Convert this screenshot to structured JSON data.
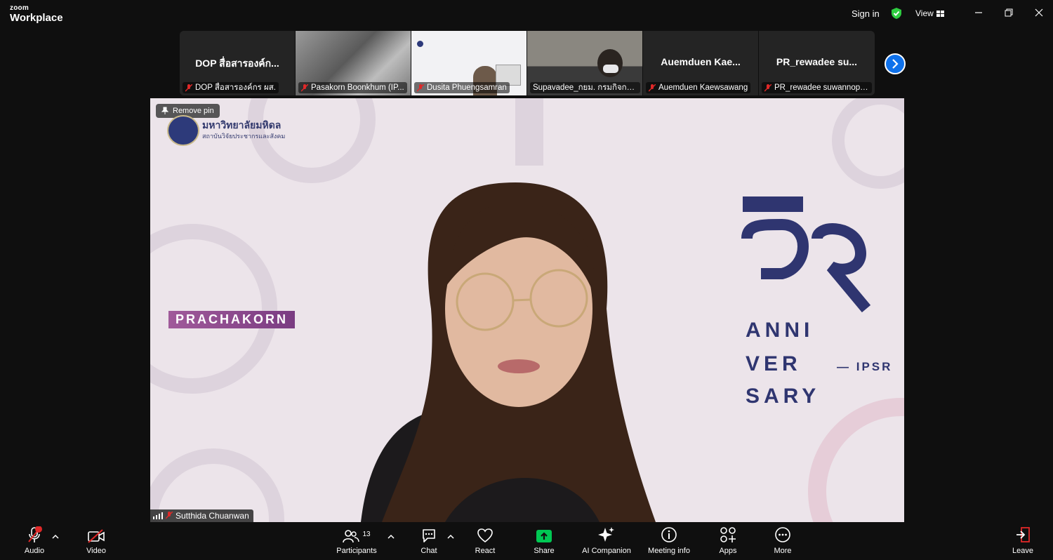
{
  "app": {
    "brand_small": "zoom",
    "brand_large": "Workplace"
  },
  "titlebar": {
    "signin_label": "Sign in",
    "view_label": "View"
  },
  "thumbnails": [
    {
      "big_name": "DOP สื่อสารองค์ก...",
      "caption": "DOP สื่อสารองค์กร ผส."
    },
    {
      "big_name": "",
      "caption": "Pasakorn Boonkhum (IP..."
    },
    {
      "big_name": "",
      "caption": "Dusita Phuengsamran"
    },
    {
      "big_name": "",
      "caption": "Supavadee_กยม. กรมกิจการ..."
    },
    {
      "big_name": "Auemduen Kae...",
      "caption": "Auemduen Kaewsawang"
    },
    {
      "big_name": "PR_rewadee su...",
      "caption": "PR_rewadee suwannopp..."
    }
  ],
  "main_video": {
    "remove_pin_label": "Remove pin",
    "org_name": "มหาวิทยาลัยมหิดล",
    "org_sub": "สถาบันวิจัยประชากรและสังคม",
    "banner_label": "PRACHAKORN",
    "anniv_lines": [
      "ANNI",
      "VER",
      "SARY"
    ],
    "anniv_tag": "— IPSR",
    "speaker_name": "Sutthida Chuanwan"
  },
  "toolbar": {
    "audio": "Audio",
    "video": "Video",
    "participants": "Participants",
    "participants_count": "13",
    "chat": "Chat",
    "react": "React",
    "share": "Share",
    "ai_companion": "AI Companion",
    "meeting_info": "Meeting info",
    "apps": "Apps",
    "more": "More",
    "leave": "Leave"
  },
  "colors": {
    "accent_blue": "#0e71eb",
    "share_green": "#00c853",
    "mute_red": "#e02828",
    "secure_green": "#2ecc40"
  }
}
